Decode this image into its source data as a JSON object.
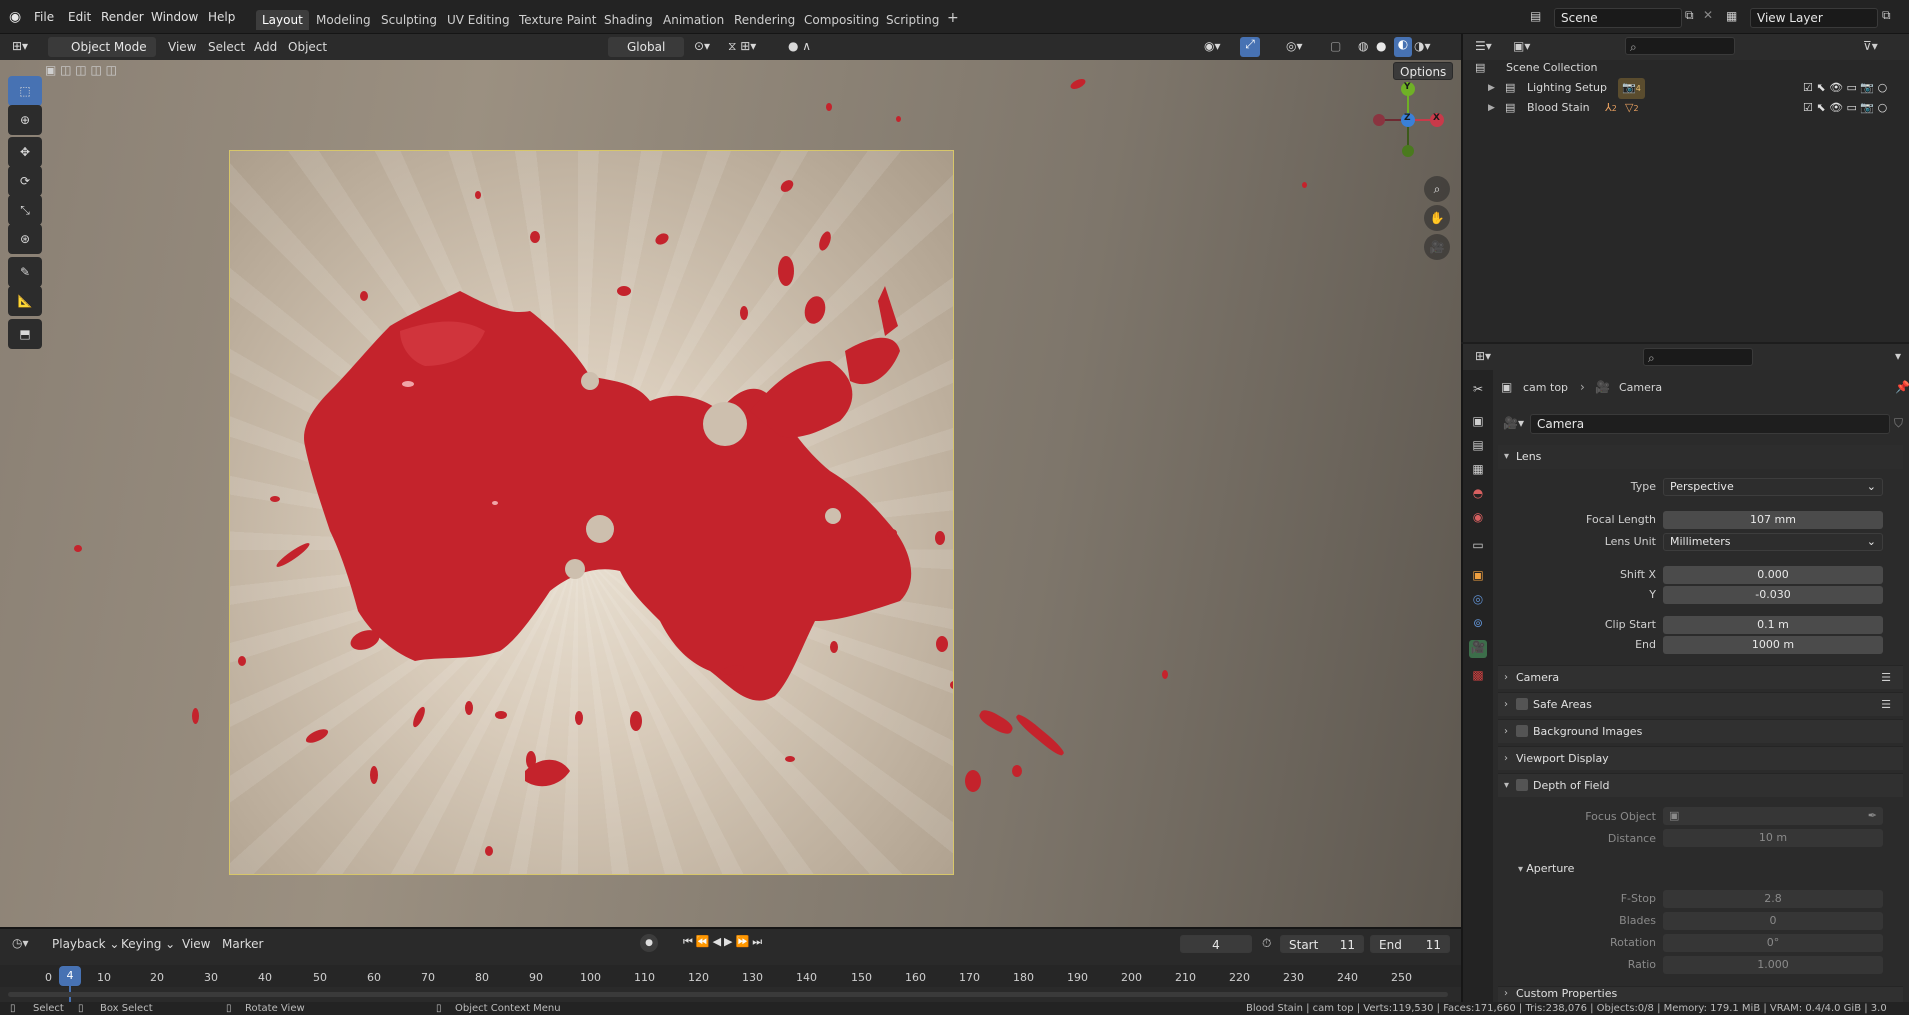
{
  "menubar": {
    "items": [
      "File",
      "Edit",
      "Render",
      "Window",
      "Help"
    ]
  },
  "workspaces": [
    "Layout",
    "Modeling",
    "Sculpting",
    "UV Editing",
    "Texture Paint",
    "Shading",
    "Animation",
    "Rendering",
    "Compositing",
    "Scripting"
  ],
  "workspace_add": "+",
  "scene": {
    "label": "Scene",
    "view_layer": "View Layer"
  },
  "viewport_header": {
    "mode": "Object Mode",
    "menus": [
      "View",
      "Select",
      "Add",
      "Object"
    ],
    "transform_orientation": "Global",
    "options": "Options"
  },
  "gizmo": {
    "x": "X",
    "y": "Y",
    "z": "Z"
  },
  "outliner": {
    "root": "Scene Collection",
    "items": [
      {
        "label": "Lighting Setup",
        "badge": "4"
      },
      {
        "label": "Blood Stain",
        "badge1": "2",
        "badge2": "2"
      }
    ]
  },
  "properties": {
    "breadcrumb_object": "cam top",
    "breadcrumb_data": "Camera",
    "datablock": "Camera",
    "lens": {
      "title": "Lens",
      "type_label": "Type",
      "type_value": "Perspective",
      "focal_label": "Focal Length",
      "focal_value": "107 mm",
      "unit_label": "Lens Unit",
      "unit_value": "Millimeters",
      "shiftx_label": "Shift X",
      "shiftx_value": "0.000",
      "y_label": "Y",
      "y_value": "-0.030",
      "clipstart_label": "Clip Start",
      "clipstart_value": "0.1 m",
      "end_label": "End",
      "end_value": "1000 m"
    },
    "panels": {
      "camera": "Camera",
      "safe_areas": "Safe Areas",
      "background_images": "Background Images",
      "viewport_display": "Viewport Display",
      "dof": "Depth of Field",
      "custom_props": "Custom Properties"
    },
    "dof": {
      "focus_label": "Focus Object",
      "distance_label": "Distance",
      "distance_value": "10 m",
      "aperture": "Aperture",
      "fstop_label": "F-Stop",
      "fstop_value": "2.8",
      "blades_label": "Blades",
      "blades_value": "0",
      "rotation_label": "Rotation",
      "rotation_value": "0°",
      "ratio_label": "Ratio",
      "ratio_value": "1.000"
    }
  },
  "timeline": {
    "menus": [
      "Playback",
      "Keying",
      "View",
      "Marker"
    ],
    "current_frame": "4",
    "start_label": "Start",
    "start_value": "11",
    "end_label": "End",
    "end_value": "11",
    "playhead": "4",
    "ticks": [
      "0",
      "10",
      "20",
      "30",
      "40",
      "50",
      "60",
      "70",
      "80",
      "90",
      "100",
      "110",
      "120",
      "130",
      "140",
      "150",
      "160",
      "170",
      "180",
      "190",
      "200",
      "210",
      "220",
      "230",
      "240",
      "250"
    ]
  },
  "statusbar": {
    "select": "Select",
    "box_select": "Box Select",
    "rotate_view": "Rotate View",
    "context_menu": "Object Context Menu",
    "stats": "Blood Stain | cam top | Verts:119,530 | Faces:171,660 | Tris:238,076 | Objects:0/8 | Memory: 179.1 MiB | VRAM: 0.4/4.0 GiB | 3.0"
  },
  "colors": {
    "accent": "#4772b3",
    "blood": "#c4232c",
    "frame_border": "#d7c66a"
  },
  "icons": [
    "blender-logo-icon",
    "select-box-icon",
    "cursor-icon",
    "move-icon",
    "rotate-icon",
    "scale-icon",
    "transform-icon",
    "annotate-icon",
    "measure-icon",
    "add-cube-icon",
    "zoom-icon",
    "hand-pan-icon",
    "camera-view-icon",
    "camera-data-icon"
  ]
}
